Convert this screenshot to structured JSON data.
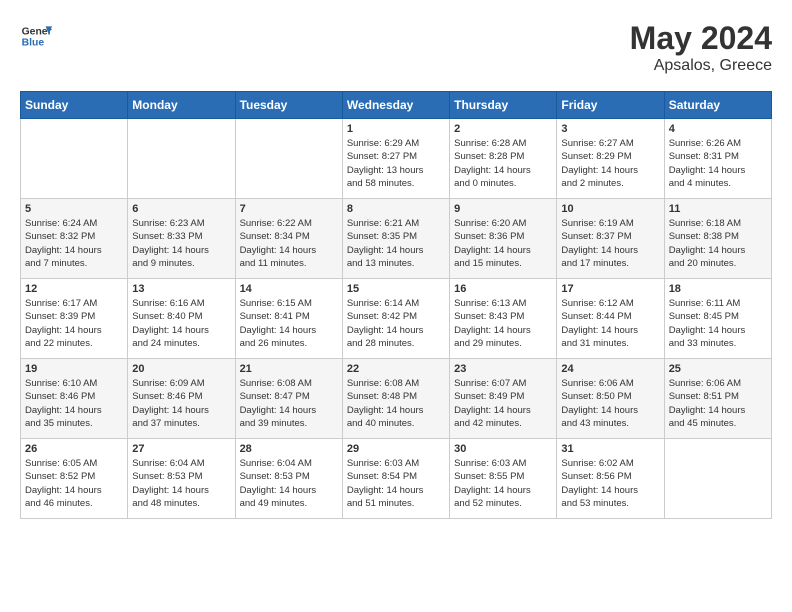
{
  "header": {
    "logo_general": "General",
    "logo_blue": "Blue",
    "month": "May 2024",
    "location": "Apsalos, Greece"
  },
  "weekdays": [
    "Sunday",
    "Monday",
    "Tuesday",
    "Wednesday",
    "Thursday",
    "Friday",
    "Saturday"
  ],
  "weeks": [
    [
      {
        "day": "",
        "info": ""
      },
      {
        "day": "",
        "info": ""
      },
      {
        "day": "",
        "info": ""
      },
      {
        "day": "1",
        "info": "Sunrise: 6:29 AM\nSunset: 8:27 PM\nDaylight: 13 hours\nand 58 minutes."
      },
      {
        "day": "2",
        "info": "Sunrise: 6:28 AM\nSunset: 8:28 PM\nDaylight: 14 hours\nand 0 minutes."
      },
      {
        "day": "3",
        "info": "Sunrise: 6:27 AM\nSunset: 8:29 PM\nDaylight: 14 hours\nand 2 minutes."
      },
      {
        "day": "4",
        "info": "Sunrise: 6:26 AM\nSunset: 8:31 PM\nDaylight: 14 hours\nand 4 minutes."
      }
    ],
    [
      {
        "day": "5",
        "info": "Sunrise: 6:24 AM\nSunset: 8:32 PM\nDaylight: 14 hours\nand 7 minutes."
      },
      {
        "day": "6",
        "info": "Sunrise: 6:23 AM\nSunset: 8:33 PM\nDaylight: 14 hours\nand 9 minutes."
      },
      {
        "day": "7",
        "info": "Sunrise: 6:22 AM\nSunset: 8:34 PM\nDaylight: 14 hours\nand 11 minutes."
      },
      {
        "day": "8",
        "info": "Sunrise: 6:21 AM\nSunset: 8:35 PM\nDaylight: 14 hours\nand 13 minutes."
      },
      {
        "day": "9",
        "info": "Sunrise: 6:20 AM\nSunset: 8:36 PM\nDaylight: 14 hours\nand 15 minutes."
      },
      {
        "day": "10",
        "info": "Sunrise: 6:19 AM\nSunset: 8:37 PM\nDaylight: 14 hours\nand 17 minutes."
      },
      {
        "day": "11",
        "info": "Sunrise: 6:18 AM\nSunset: 8:38 PM\nDaylight: 14 hours\nand 20 minutes."
      }
    ],
    [
      {
        "day": "12",
        "info": "Sunrise: 6:17 AM\nSunset: 8:39 PM\nDaylight: 14 hours\nand 22 minutes."
      },
      {
        "day": "13",
        "info": "Sunrise: 6:16 AM\nSunset: 8:40 PM\nDaylight: 14 hours\nand 24 minutes."
      },
      {
        "day": "14",
        "info": "Sunrise: 6:15 AM\nSunset: 8:41 PM\nDaylight: 14 hours\nand 26 minutes."
      },
      {
        "day": "15",
        "info": "Sunrise: 6:14 AM\nSunset: 8:42 PM\nDaylight: 14 hours\nand 28 minutes."
      },
      {
        "day": "16",
        "info": "Sunrise: 6:13 AM\nSunset: 8:43 PM\nDaylight: 14 hours\nand 29 minutes."
      },
      {
        "day": "17",
        "info": "Sunrise: 6:12 AM\nSunset: 8:44 PM\nDaylight: 14 hours\nand 31 minutes."
      },
      {
        "day": "18",
        "info": "Sunrise: 6:11 AM\nSunset: 8:45 PM\nDaylight: 14 hours\nand 33 minutes."
      }
    ],
    [
      {
        "day": "19",
        "info": "Sunrise: 6:10 AM\nSunset: 8:46 PM\nDaylight: 14 hours\nand 35 minutes."
      },
      {
        "day": "20",
        "info": "Sunrise: 6:09 AM\nSunset: 8:46 PM\nDaylight: 14 hours\nand 37 minutes."
      },
      {
        "day": "21",
        "info": "Sunrise: 6:08 AM\nSunset: 8:47 PM\nDaylight: 14 hours\nand 39 minutes."
      },
      {
        "day": "22",
        "info": "Sunrise: 6:08 AM\nSunset: 8:48 PM\nDaylight: 14 hours\nand 40 minutes."
      },
      {
        "day": "23",
        "info": "Sunrise: 6:07 AM\nSunset: 8:49 PM\nDaylight: 14 hours\nand 42 minutes."
      },
      {
        "day": "24",
        "info": "Sunrise: 6:06 AM\nSunset: 8:50 PM\nDaylight: 14 hours\nand 43 minutes."
      },
      {
        "day": "25",
        "info": "Sunrise: 6:06 AM\nSunset: 8:51 PM\nDaylight: 14 hours\nand 45 minutes."
      }
    ],
    [
      {
        "day": "26",
        "info": "Sunrise: 6:05 AM\nSunset: 8:52 PM\nDaylight: 14 hours\nand 46 minutes."
      },
      {
        "day": "27",
        "info": "Sunrise: 6:04 AM\nSunset: 8:53 PM\nDaylight: 14 hours\nand 48 minutes."
      },
      {
        "day": "28",
        "info": "Sunrise: 6:04 AM\nSunset: 8:53 PM\nDaylight: 14 hours\nand 49 minutes."
      },
      {
        "day": "29",
        "info": "Sunrise: 6:03 AM\nSunset: 8:54 PM\nDaylight: 14 hours\nand 51 minutes."
      },
      {
        "day": "30",
        "info": "Sunrise: 6:03 AM\nSunset: 8:55 PM\nDaylight: 14 hours\nand 52 minutes."
      },
      {
        "day": "31",
        "info": "Sunrise: 6:02 AM\nSunset: 8:56 PM\nDaylight: 14 hours\nand 53 minutes."
      },
      {
        "day": "",
        "info": ""
      }
    ]
  ]
}
